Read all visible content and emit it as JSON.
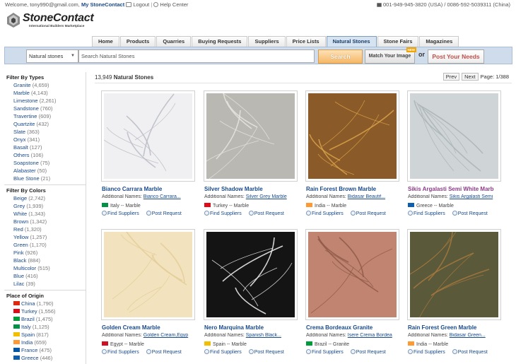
{
  "topbar": {
    "welcome": "Welcome, tony990@gmail.com,",
    "my_account": "My StoneContact",
    "logout": "Logout",
    "help": "Help Center",
    "phones": "001-949-945-3820 (USA) / 0086-592-5039311 (China)"
  },
  "logo": {
    "name": "StoneContact",
    "tagline": "International Builders Marketplace"
  },
  "nav": {
    "tabs": [
      {
        "label": "Home"
      },
      {
        "label": "Products"
      },
      {
        "label": "Quarries"
      },
      {
        "label": "Buying Requests"
      },
      {
        "label": "Suppliers"
      },
      {
        "label": "Price Lists"
      },
      {
        "label": "Natural Stones",
        "active": true
      },
      {
        "label": "Stone Fairs"
      },
      {
        "label": "Magazines"
      }
    ]
  },
  "search": {
    "category": "Natural stones",
    "placeholder": "Search Natural Stones",
    "search_label": "Search",
    "match_label": "Match Your Image",
    "new_badge": "NEW",
    "or_label": "or",
    "post_label": "Post Your Needs"
  },
  "sidebar": {
    "types_title": "Filter By Types",
    "types": [
      {
        "label": "Granite",
        "count": "(4,659)"
      },
      {
        "label": "Marble",
        "count": "(4,143)"
      },
      {
        "label": "Limestone",
        "count": "(2,261)"
      },
      {
        "label": "Sandstone",
        "count": "(760)"
      },
      {
        "label": "Travertine",
        "count": "(609)"
      },
      {
        "label": "Quartzite",
        "count": "(432)"
      },
      {
        "label": "Slate",
        "count": "(363)"
      },
      {
        "label": "Onyx",
        "count": "(341)"
      },
      {
        "label": "Basalt",
        "count": "(127)"
      },
      {
        "label": "Others",
        "count": "(106)"
      },
      {
        "label": "Soapstone",
        "count": "(75)"
      },
      {
        "label": "Alabaster",
        "count": "(50)"
      },
      {
        "label": "Blue Stone",
        "count": "(21)"
      }
    ],
    "colors_title": "Filter By Colors",
    "colors": [
      {
        "label": "Beige",
        "count": "(2,742)"
      },
      {
        "label": "Grey",
        "count": "(1,939)"
      },
      {
        "label": "White",
        "count": "(1,343)"
      },
      {
        "label": "Brown",
        "count": "(1,342)"
      },
      {
        "label": "Red",
        "count": "(1,320)"
      },
      {
        "label": "Yellow",
        "count": "(1,257)"
      },
      {
        "label": "Green",
        "count": "(1,170)"
      },
      {
        "label": "Pink",
        "count": "(926)"
      },
      {
        "label": "Black",
        "count": "(884)"
      },
      {
        "label": "Multicolor",
        "count": "(515)"
      },
      {
        "label": "Blue",
        "count": "(416)"
      },
      {
        "label": "Lilac",
        "count": "(39)"
      }
    ],
    "origin_title": "Place of Origin",
    "origins": [
      {
        "label": "China",
        "count": "(1,790)",
        "flag": "#de2910"
      },
      {
        "label": "Turkey",
        "count": "(1,556)",
        "flag": "#e30a17"
      },
      {
        "label": "Brazil",
        "count": "(1,475)",
        "flag": "#009c3b"
      },
      {
        "label": "Italy",
        "count": "(1,125)",
        "flag": "#009246"
      },
      {
        "label": "Spain",
        "count": "(817)",
        "flag": "#f1bf00"
      },
      {
        "label": "India",
        "count": "(659)",
        "flag": "#ff9933"
      },
      {
        "label": "France",
        "count": "(475)",
        "flag": "#0055a4"
      },
      {
        "label": "Greece",
        "count": "(446)",
        "flag": "#0d5eaf"
      }
    ]
  },
  "results": {
    "count": "13,949",
    "label": "Natural Stones",
    "prev": "Prev",
    "next": "Next",
    "page": "Page: 1/388"
  },
  "products": [
    {
      "title": "Bianco Carrara Marble",
      "addl_label": "Additional Names:",
      "addl": "Bianco Carrara...",
      "origin": "Italy -- Marble",
      "flag": "#009246",
      "find": "Find Suppliers",
      "post": "Post Request",
      "base": "#f0f0f2",
      "vein": "#b9bcc4",
      "visited": false
    },
    {
      "title": "Silver Shadow Marble",
      "addl_label": "Additional Names:",
      "addl": "Silver Grey Marble",
      "origin": "Turkey -- Marble",
      "flag": "#e30a17",
      "find": "Find Suppliers",
      "post": "Post Request",
      "base": "#b9b8b2",
      "vein": "#e6e5e0",
      "visited": false
    },
    {
      "title": "Rain Forest Brown Marble",
      "addl_label": "Additional Names:",
      "addl": "Bidasar Beautif...",
      "origin": "India -- Marble",
      "flag": "#ff9933",
      "find": "Find Suppliers",
      "post": "Post Request",
      "base": "#8a5a28",
      "vein": "#d9a24a",
      "visited": false
    },
    {
      "title": "Sikis Argalasti Semi White Marb",
      "addl_label": "Additional Names:",
      "addl": "Sikis Argalasti Semi",
      "origin": "Greece -- Marble",
      "flag": "#0d5eaf",
      "find": "Find Suppliers",
      "post": "Post Request",
      "base": "#cfd5d6",
      "vein": "#aab4b5",
      "visited": true
    },
    {
      "title": "Golden Cream Marble",
      "addl_label": "Additional Names:",
      "addl": "Golden Cream,Egyp",
      "origin": "Egypt -- Marble",
      "flag": "#ce1126",
      "find": "Find Suppliers",
      "post": "Post Request",
      "base": "#f2e2bd",
      "vein": "#e3cc99",
      "visited": false
    },
    {
      "title": "Nero Marquina Marble",
      "addl_label": "Additional Names:",
      "addl": "Spanish Black...",
      "origin": "Spain -- Marble",
      "flag": "#f1bf00",
      "find": "Find Suppliers",
      "post": "Post Request",
      "base": "#141414",
      "vein": "#f2f2f2",
      "visited": false
    },
    {
      "title": "Crema Bordeaux Granite",
      "addl_label": "Additional Names:",
      "addl": "Isere Crema Bordea",
      "origin": "Brazil -- Granite",
      "flag": "#009c3b",
      "find": "Find Suppliers",
      "post": "Post Request",
      "base": "#c08470",
      "vein": "#8e5848",
      "visited": false
    },
    {
      "title": "Rain Forest Green Marble",
      "addl_label": "Additional Names:",
      "addl": "Bidasar Green...",
      "origin": "India -- Marble",
      "flag": "#ff9933",
      "find": "Find Suppliers",
      "post": "Post Request",
      "base": "#5a5a3a",
      "vein": "#a8783e",
      "visited": false
    }
  ]
}
